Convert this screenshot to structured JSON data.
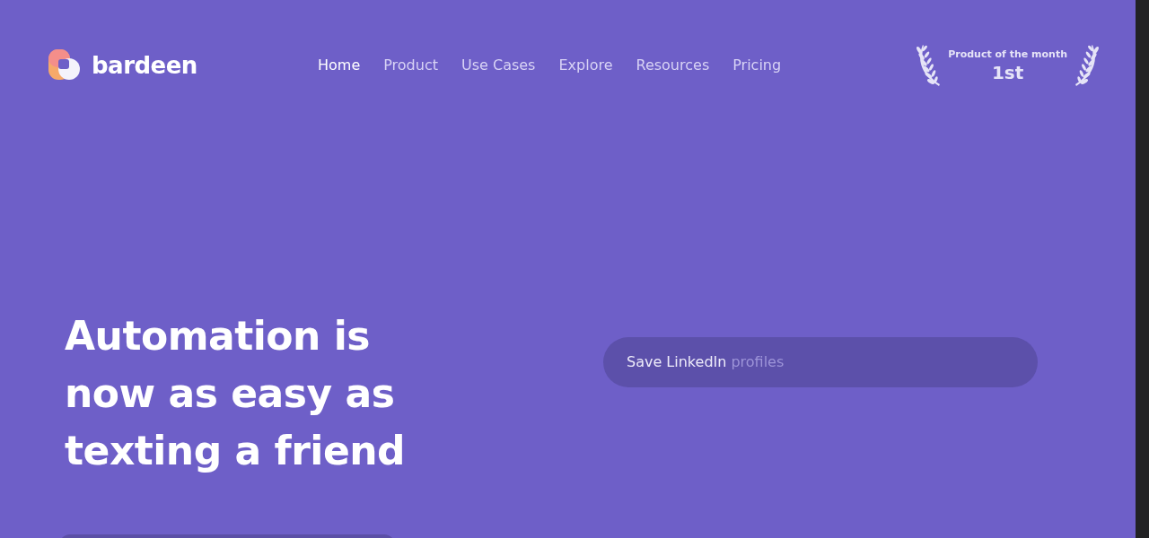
{
  "logo": {
    "text": "bardeen"
  },
  "nav": [
    {
      "label": "Home",
      "selected": true
    },
    {
      "label": "Product",
      "selected": false
    },
    {
      "label": "Use Cases",
      "selected": false
    },
    {
      "label": "Explore",
      "selected": false
    },
    {
      "label": "Resources",
      "selected": false
    },
    {
      "label": "Pricing",
      "selected": false
    }
  ],
  "award": {
    "title": "Product of the month",
    "rank": "1st"
  },
  "hero": {
    "headline": [
      "Automation is",
      "now as easy as",
      "texting a friend"
    ]
  },
  "prompt": {
    "typed": "Save LinkedIn",
    "suggestion": "profiles"
  }
}
